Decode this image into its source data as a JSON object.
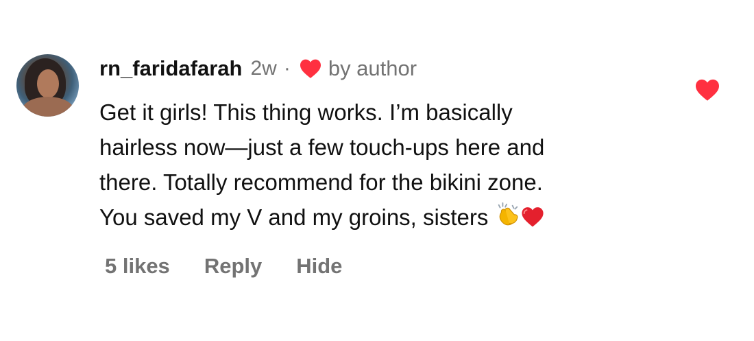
{
  "comment": {
    "username": "rn_faridafarah",
    "age": "2w",
    "separator": "·",
    "liked_by": "by author",
    "text_lines": [
      "Get it girls! This thing works. I’m basically",
      "hairless now—just a few touch-ups here and",
      "there. Totally recommend for the bikini zone.",
      "You saved my V and my groins, sisters"
    ],
    "emojis": [
      "clapping-hands",
      "red-heart"
    ],
    "likes": "5 likes",
    "reply_label": "Reply",
    "hide_label": "Hide"
  },
  "colors": {
    "heart_red": "#ff3040",
    "secondary_text": "#737373",
    "primary_text": "#111111"
  },
  "icons": {
    "liked_by_author": "heart-icon",
    "like_button": "heart-icon"
  }
}
